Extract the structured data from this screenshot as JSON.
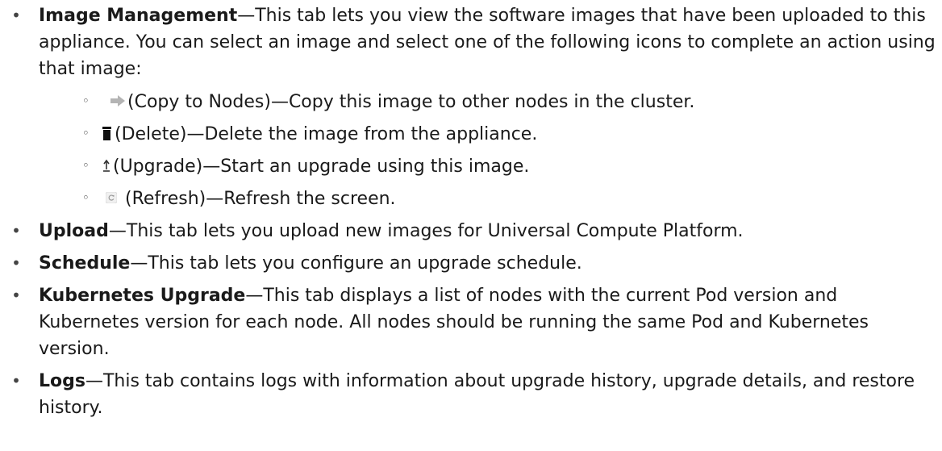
{
  "list": {
    "image_management": {
      "term": "Image Management",
      "desc": "—This tab lets you view the software images that have been uploaded to this appliance. You can select an image and select one of the following icons to complete an action using that image:",
      "actions": [
        {
          "icon": "arrow-right-icon",
          "name": "(Copy to Nodes)",
          "desc": "—Copy this image to other nodes in the cluster."
        },
        {
          "icon": "trash-icon",
          "name": "(Delete)",
          "desc": "—Delete the image from the appliance."
        },
        {
          "icon": "upgrade-icon",
          "name": "(Upgrade)",
          "desc": "—Start an upgrade using this image."
        },
        {
          "icon": "refresh-icon",
          "name": "(Refresh)",
          "desc": "—Refresh the screen."
        }
      ]
    },
    "upload": {
      "term": "Upload",
      "desc": "—This tab lets you upload new images for Universal Compute Platform."
    },
    "schedule": {
      "term": "Schedule",
      "desc": "—This tab lets you configure an upgrade schedule."
    },
    "kubernetes_upgrade": {
      "term": "Kubernetes Upgrade",
      "desc": "—This tab displays a list of nodes with the current Pod version and Kubernetes version for each node. All nodes should be running the same Pod and Kubernetes version."
    },
    "logs": {
      "term": "Logs",
      "desc": "—This tab contains logs with information about upgrade history, upgrade details, and restore history."
    }
  }
}
